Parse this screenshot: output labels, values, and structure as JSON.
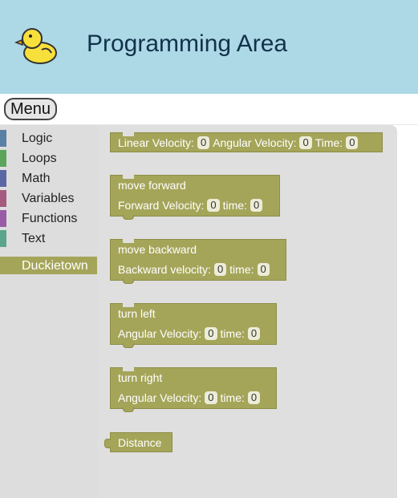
{
  "header": {
    "title": "Programming Area",
    "logo": "duck-logo"
  },
  "menu": {
    "label": "Menu"
  },
  "toolbox": {
    "categories": [
      {
        "label": "Logic",
        "color": "#5b80a5"
      },
      {
        "label": "Loops",
        "color": "#5ba55b"
      },
      {
        "label": "Math",
        "color": "#5b67a5"
      },
      {
        "label": "Variables",
        "color": "#a55b80"
      },
      {
        "label": "Functions",
        "color": "#995ba5"
      },
      {
        "label": "Text",
        "color": "#5ba58c"
      },
      {
        "label": "Duckietown",
        "color": "#a5a55a"
      }
    ]
  },
  "blocks": {
    "velocity": {
      "linear_label": "Linear Velocity:",
      "linear_value": "0",
      "angular_label": "Angular Velocity:",
      "angular_value": "0",
      "time_label": "Time:",
      "time_value": "0"
    },
    "forward": {
      "title": "move forward",
      "vel_label": "Forward Velocity:",
      "vel_value": "0",
      "time_label": "time:",
      "time_value": "0"
    },
    "backward": {
      "title": "move backward",
      "vel_label": "Backward velocity:",
      "vel_value": "0",
      "time_label": "time:",
      "time_value": "0"
    },
    "left": {
      "title": "turn left",
      "vel_label": "Angular Velocity:",
      "vel_value": "0",
      "time_label": "time:",
      "time_value": "0"
    },
    "right": {
      "title": "turn right",
      "vel_label": "Angular Velocity:",
      "vel_value": "0",
      "time_label": "time:",
      "time_value": "0"
    },
    "distance": {
      "label": "Distance"
    }
  },
  "colors": {
    "header_bg": "#add8e6",
    "block": "#a5a55a",
    "toolbox_bg": "#dddddd",
    "flyout_bg": "#dfdfdf"
  }
}
